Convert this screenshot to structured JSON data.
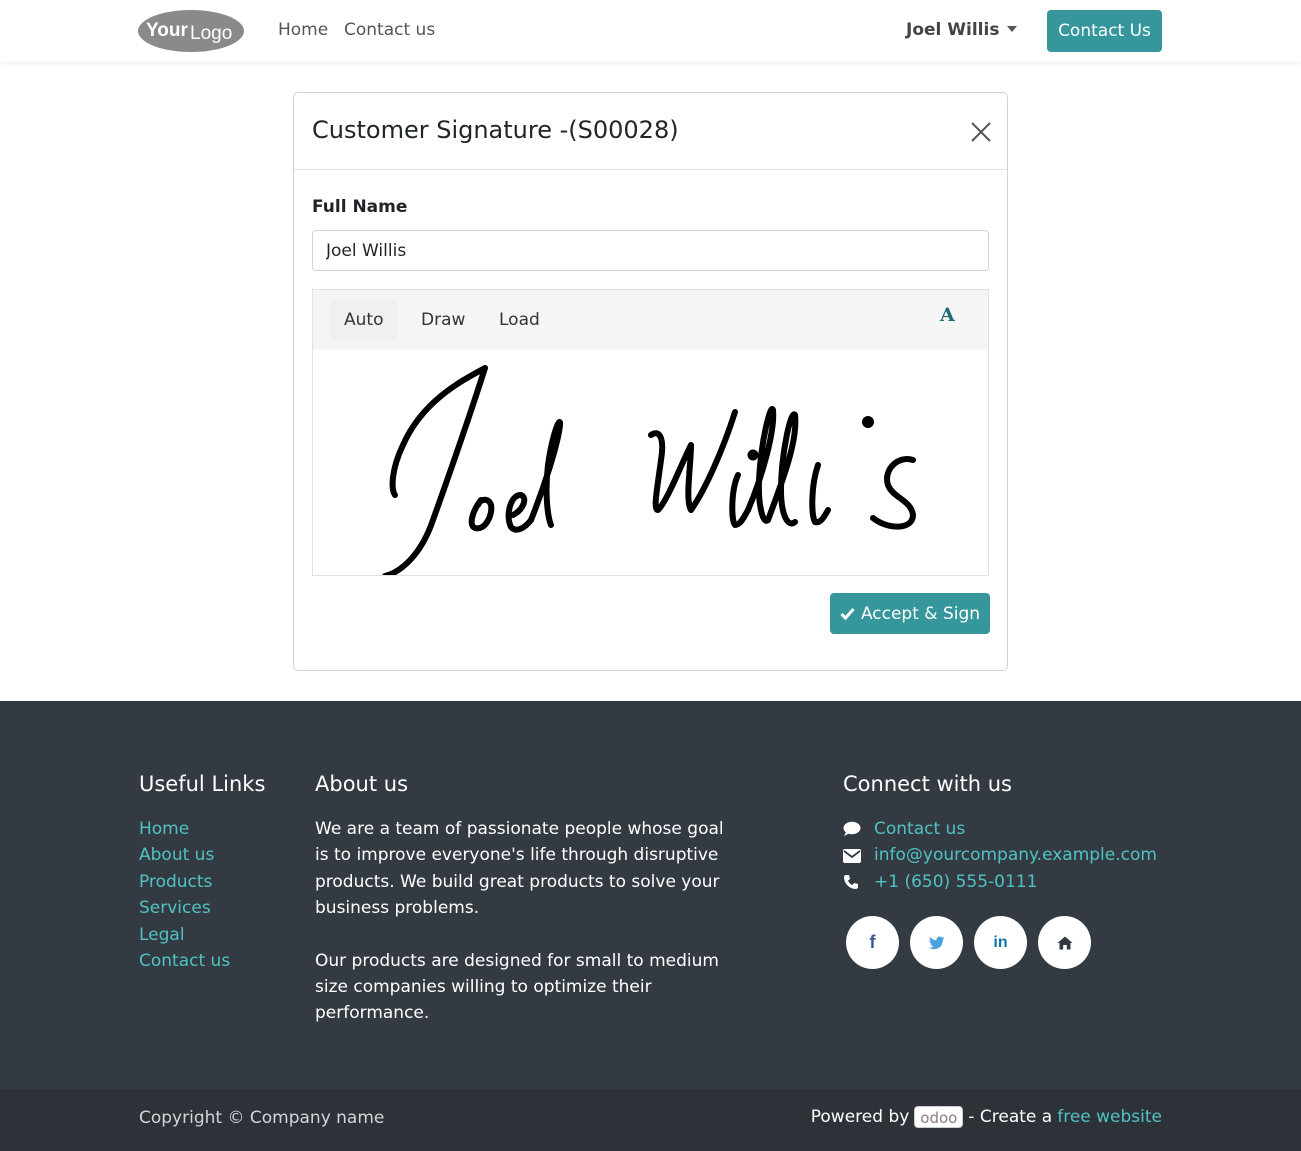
{
  "header": {
    "logo_text_bold": "Your",
    "logo_text_light": "Logo",
    "nav": [
      {
        "label": "Home"
      },
      {
        "label": "Contact us"
      }
    ],
    "user_name": "Joel Willis",
    "contact_button": "Contact Us"
  },
  "modal": {
    "title": "Customer Signature -(S00028)",
    "full_name_label": "Full Name",
    "full_name_value": "Joel Willis",
    "tabs": [
      {
        "label": "Auto",
        "active": true
      },
      {
        "label": "Draw",
        "active": false
      },
      {
        "label": "Load",
        "active": false
      }
    ],
    "font_icon_glyph": "A",
    "signature_text": "Joel Willis",
    "accept_button": "Accept & Sign"
  },
  "footer": {
    "useful_links_title": "Useful Links",
    "useful_links": [
      "Home",
      "About us",
      "Products",
      "Services",
      "Legal",
      "Contact us"
    ],
    "about_title": "About us",
    "about_paragraphs": [
      "We are a team of passionate people whose goal is to improve everyone's life through disruptive products. We build great products to solve your business problems.",
      "Our products are designed for small to medium size companies willing to optimize their performance."
    ],
    "connect_title": "Connect with us",
    "connect_items": [
      {
        "icon": "comment-icon",
        "label": "Contact us"
      },
      {
        "icon": "envelope-icon",
        "label": "info@yourcompany.example.com"
      },
      {
        "icon": "phone-icon",
        "label": "+1 (650) 555-0111"
      }
    ],
    "social": [
      "facebook-icon",
      "twitter-icon",
      "linkedin-icon",
      "home-icon"
    ]
  },
  "subfooter": {
    "copyright": "Copyright © Company name",
    "powered_by": "Powered by",
    "odoo_badge": "odoo",
    "create_text": "- Create a",
    "free_website": "free website"
  },
  "colors": {
    "accent": "#35979c",
    "link": "#4fc3c3",
    "footer_bg": "#343a42",
    "subfooter_bg": "#2d3138"
  }
}
